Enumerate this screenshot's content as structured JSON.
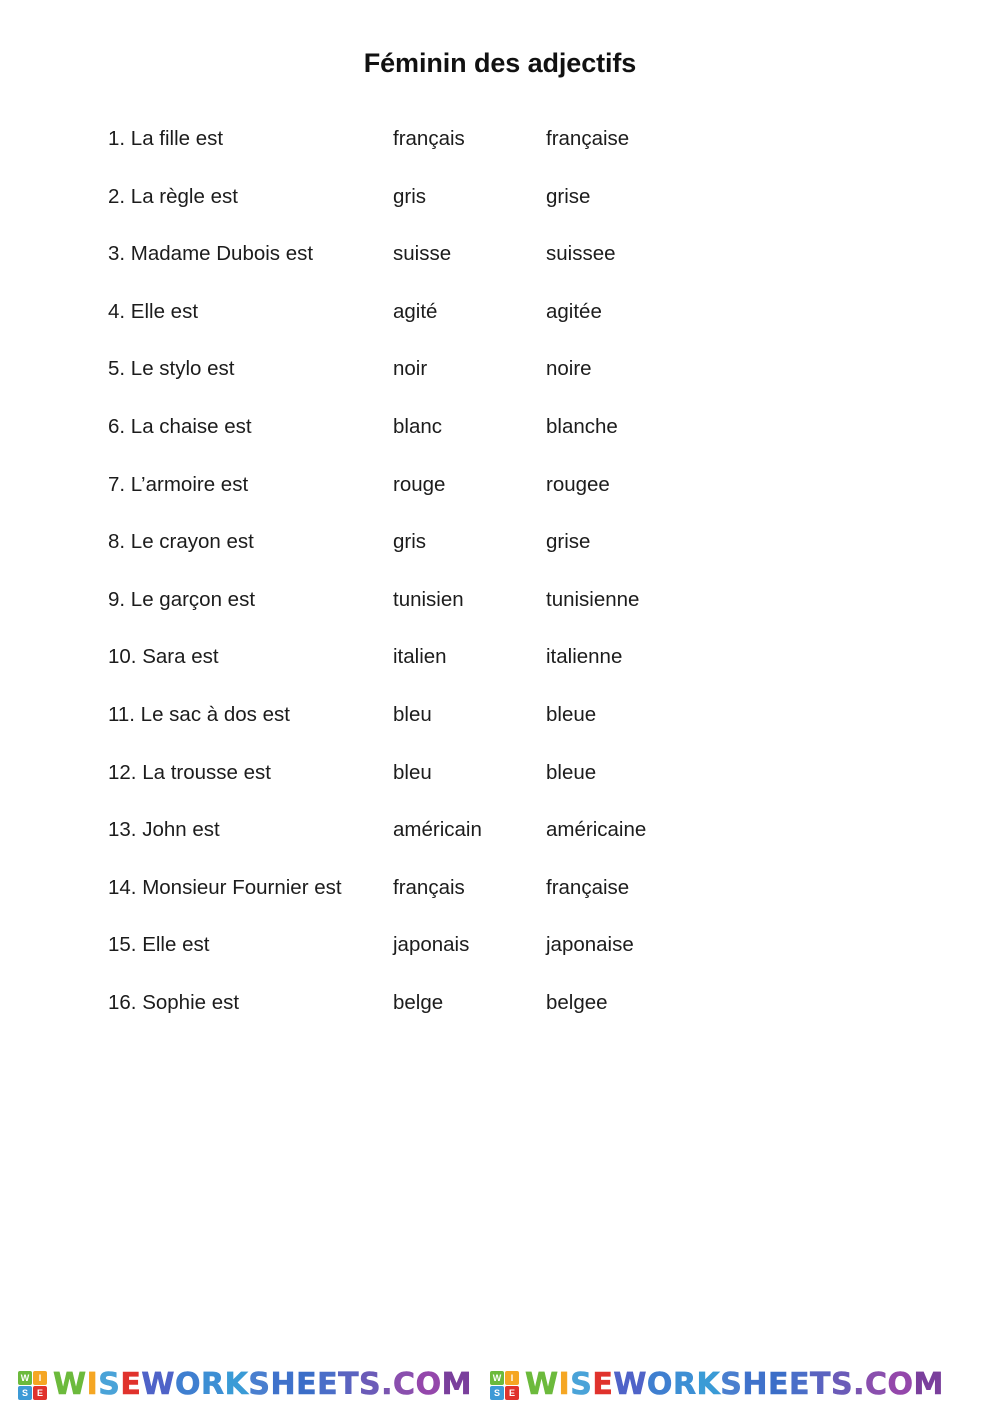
{
  "document": {
    "title": "Féminin des adjectifs",
    "background_color": "#ffffff",
    "text_color": "#1c1c1c"
  },
  "exercises": [
    {
      "number": "1.",
      "prompt": "1. La fille est",
      "masculine": "français",
      "feminine": "française"
    },
    {
      "number": "2.",
      "prompt": "2. La règle est",
      "masculine": "gris",
      "feminine": "grise"
    },
    {
      "number": "3.",
      "prompt": "3. Madame Dubois est",
      "masculine": "suisse",
      "feminine": "suissee"
    },
    {
      "number": "4.",
      "prompt": "4. Elle est",
      "masculine": "agité",
      "feminine": "agitée"
    },
    {
      "number": "5.",
      "prompt": "5. Le stylo est",
      "masculine": "noir",
      "feminine": "noire"
    },
    {
      "number": "6.",
      "prompt": "6. La chaise est",
      "masculine": "blanc",
      "feminine": "blanche"
    },
    {
      "number": "7.",
      "prompt": "7. L’armoire est",
      "masculine": "rouge",
      "feminine": "rougee"
    },
    {
      "number": "8.",
      "prompt": "8. Le crayon est",
      "masculine": "gris",
      "feminine": "grise"
    },
    {
      "number": "9.",
      "prompt": "9. Le garçon est",
      "masculine": "tunisien",
      "feminine": "tunisienne"
    },
    {
      "number": "10.",
      "prompt": "10. Sara est",
      "masculine": "italien",
      "feminine": "italienne"
    },
    {
      "number": "11.",
      "prompt": "11. Le sac à dos est",
      "masculine": "bleu",
      "feminine": "bleue"
    },
    {
      "number": "12.",
      "prompt": "12. La trousse est",
      "masculine": "bleu",
      "feminine": "bleue"
    },
    {
      "number": "13.",
      "prompt": "13. John est",
      "masculine": "américain",
      "feminine": "américaine"
    },
    {
      "number": "14.",
      "prompt": "14. Monsieur Fournier est",
      "masculine": "français",
      "feminine": "française"
    },
    {
      "number": "15.",
      "prompt": "15. Elle est",
      "masculine": "japonais",
      "feminine": "japonaise"
    },
    {
      "number": "16.",
      "prompt": "16. Sophie est",
      "masculine": "belge",
      "feminine": "belgee"
    }
  ],
  "watermark": {
    "text": "WISEWORKSHEETS.COM",
    "logo_letters": [
      "W",
      "I",
      "S",
      "E"
    ],
    "logo_colors": [
      "#6cba3c",
      "#f5a623",
      "#3d9ad6",
      "#e0322c"
    ],
    "letter_colors": [
      "#6cba3c",
      "#f5a623",
      "#4aa3d8",
      "#e0322c",
      "#4f63c8",
      "#3f7fd0",
      "#3d8fd4",
      "#3a9bd6",
      "#4a7fcf",
      "#3f72cb",
      "#3b6ec8",
      "#4a6ec8",
      "#5a63c0",
      "#6b5bb8",
      "#7a55b0",
      "#8a4fae",
      "#9447ab",
      "#7a3f9c"
    ],
    "repeat_count": 2
  }
}
